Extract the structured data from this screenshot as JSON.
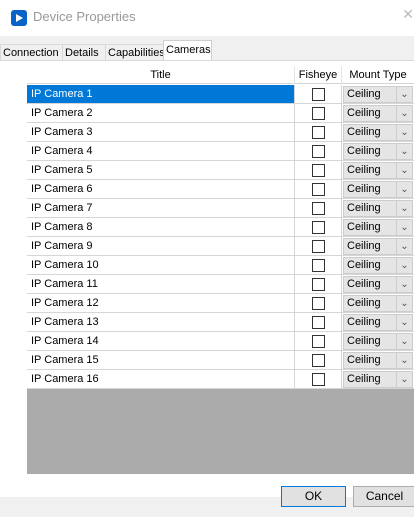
{
  "window": {
    "title": "Device Properties"
  },
  "tabs": [
    "Connection",
    "Details",
    "Capabilities",
    "Cameras"
  ],
  "active_tab": "Cameras",
  "grid": {
    "headers": {
      "title": "Title",
      "fisheye": "Fisheye",
      "mount": "Mount Type"
    },
    "rows": [
      {
        "title": "IP Camera 1",
        "fisheye": false,
        "mount": "Ceiling"
      },
      {
        "title": "IP Camera 2",
        "fisheye": false,
        "mount": "Ceiling"
      },
      {
        "title": "IP Camera 3",
        "fisheye": false,
        "mount": "Ceiling"
      },
      {
        "title": "IP Camera 4",
        "fisheye": false,
        "mount": "Ceiling"
      },
      {
        "title": "IP Camera 5",
        "fisheye": false,
        "mount": "Ceiling"
      },
      {
        "title": "IP Camera 6",
        "fisheye": false,
        "mount": "Ceiling"
      },
      {
        "title": "IP Camera 7",
        "fisheye": false,
        "mount": "Ceiling"
      },
      {
        "title": "IP Camera 8",
        "fisheye": false,
        "mount": "Ceiling"
      },
      {
        "title": "IP Camera 9",
        "fisheye": false,
        "mount": "Ceiling"
      },
      {
        "title": "IP Camera 10",
        "fisheye": false,
        "mount": "Ceiling"
      },
      {
        "title": "IP Camera 11",
        "fisheye": false,
        "mount": "Ceiling"
      },
      {
        "title": "IP Camera 12",
        "fisheye": false,
        "mount": "Ceiling"
      },
      {
        "title": "IP Camera 13",
        "fisheye": false,
        "mount": "Ceiling"
      },
      {
        "title": "IP Camera 14",
        "fisheye": false,
        "mount": "Ceiling"
      },
      {
        "title": "IP Camera 15",
        "fisheye": false,
        "mount": "Ceiling"
      },
      {
        "title": "IP Camera 16",
        "fisheye": false,
        "mount": "Ceiling"
      }
    ],
    "selected_row": 0
  },
  "buttons": {
    "ok": "OK",
    "cancel": "Cancel"
  },
  "colors": {
    "selection": "#0078d7",
    "app_icon": "#0a64c8",
    "grid_background": "#ababab"
  },
  "icons": {
    "app": "device-app-icon",
    "close": "close-icon",
    "dropdown": "chevron-down-icon"
  }
}
